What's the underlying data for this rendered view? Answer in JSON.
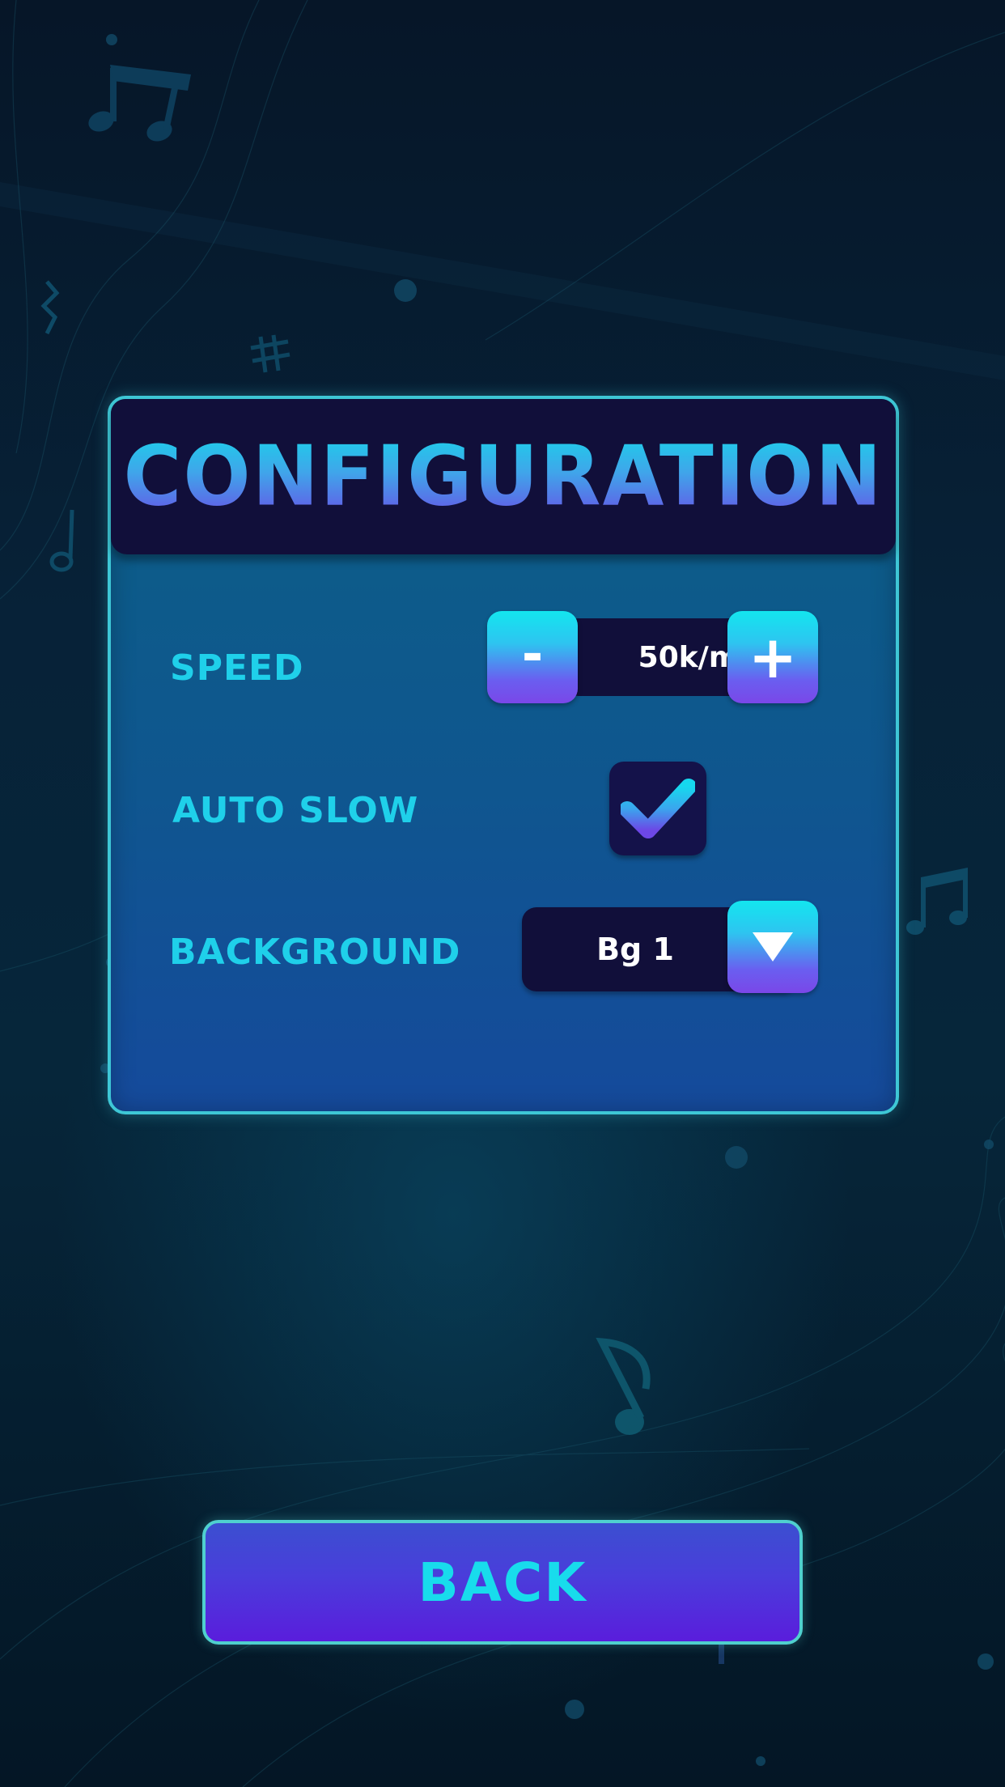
{
  "panel": {
    "title": "CONFIGURATION"
  },
  "settings": {
    "speed": {
      "label": "SPEED",
      "value": "50k/m",
      "decrement_label": "-",
      "increment_label": "+"
    },
    "auto_slow": {
      "label": "AUTO SLOW",
      "checked": true
    },
    "background": {
      "label": "BACKGROUND",
      "selected": "Bg 1"
    }
  },
  "back_button": {
    "label": "BACK"
  },
  "icons": [
    "music-note-icon",
    "sharp-icon",
    "rest-icon",
    "check-icon",
    "dropdown-arrow-icon"
  ],
  "colors": {
    "accent_cyan": "#1fd0ea",
    "accent_purple": "#6a47e8",
    "panel_dark": "#110f3a",
    "border": "#3ec7d6"
  }
}
